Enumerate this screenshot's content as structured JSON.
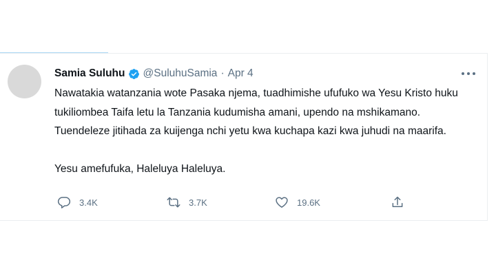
{
  "tweet": {
    "author_name": "Samia Suluhu",
    "handle": "@SuluhuSamia",
    "separator": "·",
    "date": "Apr 4",
    "paragraphs": [
      "Nawatakia watanzania wote Pasaka njema, tuadhimishe ufufuko wa Yesu Kristo huku tukiliombea Taifa letu la Tanzania kudumisha amani, upendo na mshikamano. Tuendeleze jitihada za kuijenga nchi yetu kwa kuchapa kazi kwa juhudi na maarifa.",
      "Yesu amefufuka, Haleluya Haleluya."
    ],
    "actions": {
      "replies": "3.4K",
      "retweets": "3.7K",
      "likes": "19.6K"
    },
    "icons": {
      "verified": "verified-badge-icon",
      "more": "more-options-icon",
      "reply": "reply-icon",
      "retweet": "retweet-icon",
      "like": "like-icon",
      "share": "share-icon"
    },
    "colors": {
      "verified": "#1da1f2",
      "muted": "#5b7083",
      "text": "#0f1419"
    }
  }
}
